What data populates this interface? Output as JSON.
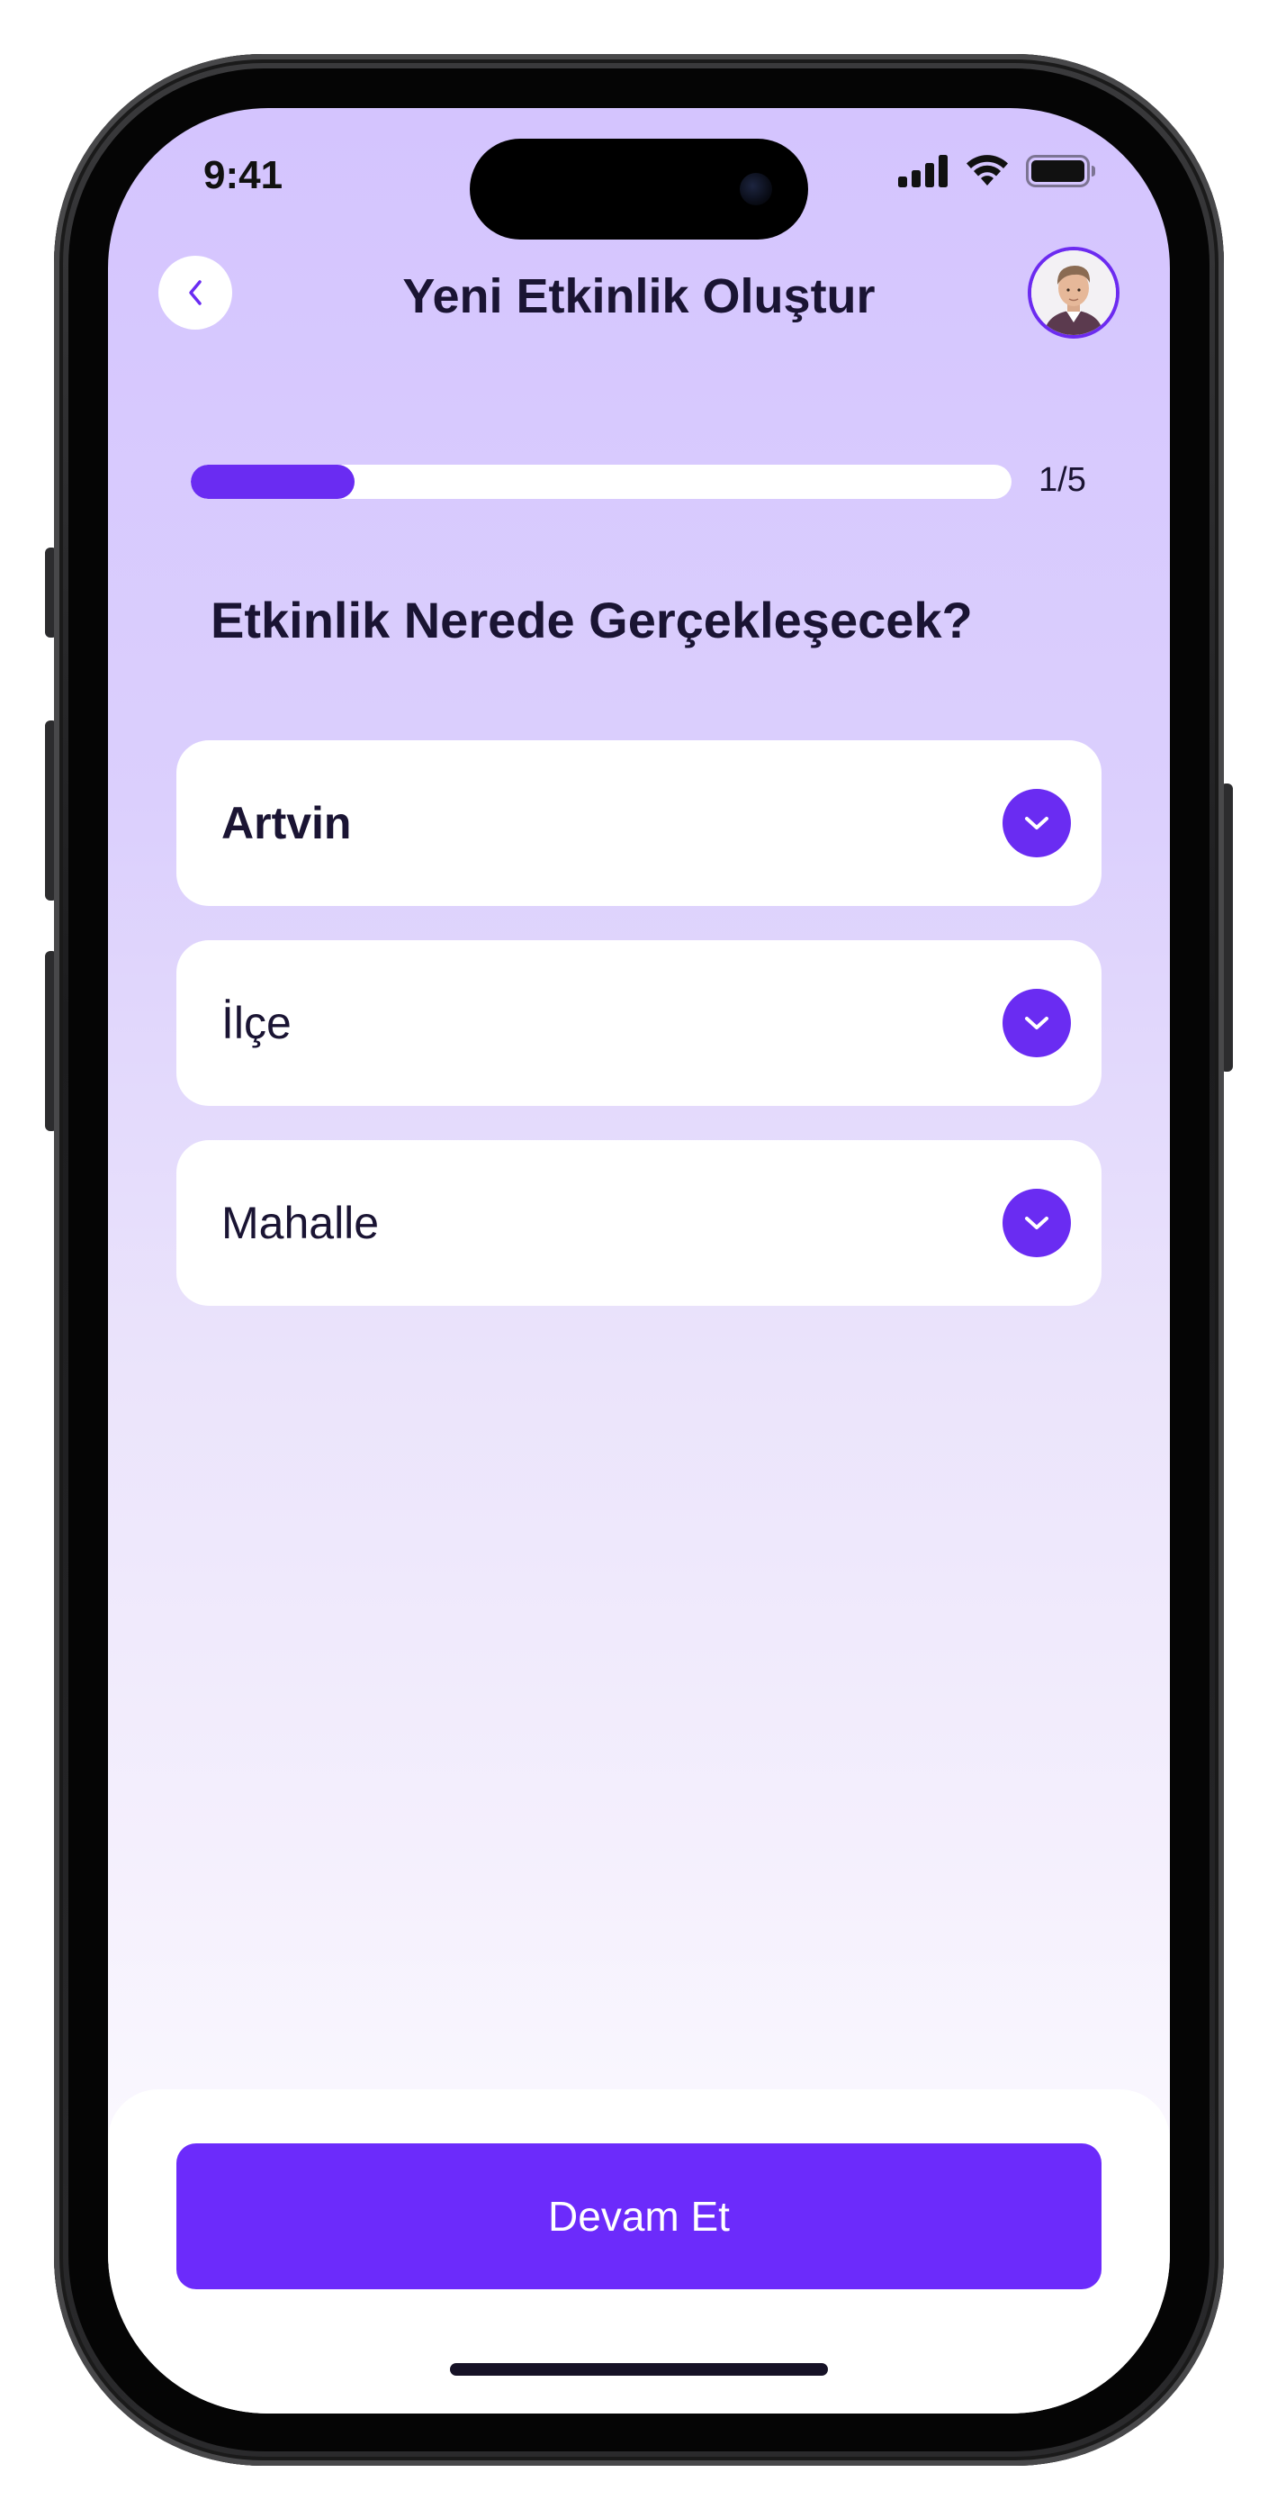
{
  "status_bar": {
    "time": "9:41",
    "icons": [
      "cellular-signal-icon",
      "wifi-icon",
      "battery-icon"
    ]
  },
  "header": {
    "title": "Yeni Etkinlik Oluştur",
    "back_icon": "chevron-left-icon",
    "avatar": "user-avatar"
  },
  "progress": {
    "current_step": 1,
    "total_steps": 5,
    "label": "1/5",
    "fill_fraction": 0.2
  },
  "question": "Etkinlik Nerede Gerçekleşecek?",
  "dropdowns": [
    {
      "value": "Artvin",
      "selected": true,
      "icon": "chevron-down-icon"
    },
    {
      "value": "İlçe",
      "selected": false,
      "icon": "chevron-down-icon"
    },
    {
      "value": "Mahalle",
      "selected": false,
      "icon": "chevron-down-icon"
    }
  ],
  "continue_button": {
    "label": "Devam Et"
  },
  "colors": {
    "accent": "#6A2CF2",
    "title_text": "#1A1433",
    "background_top": "#D4C4FE",
    "background_bottom": "#FFFFFF"
  }
}
